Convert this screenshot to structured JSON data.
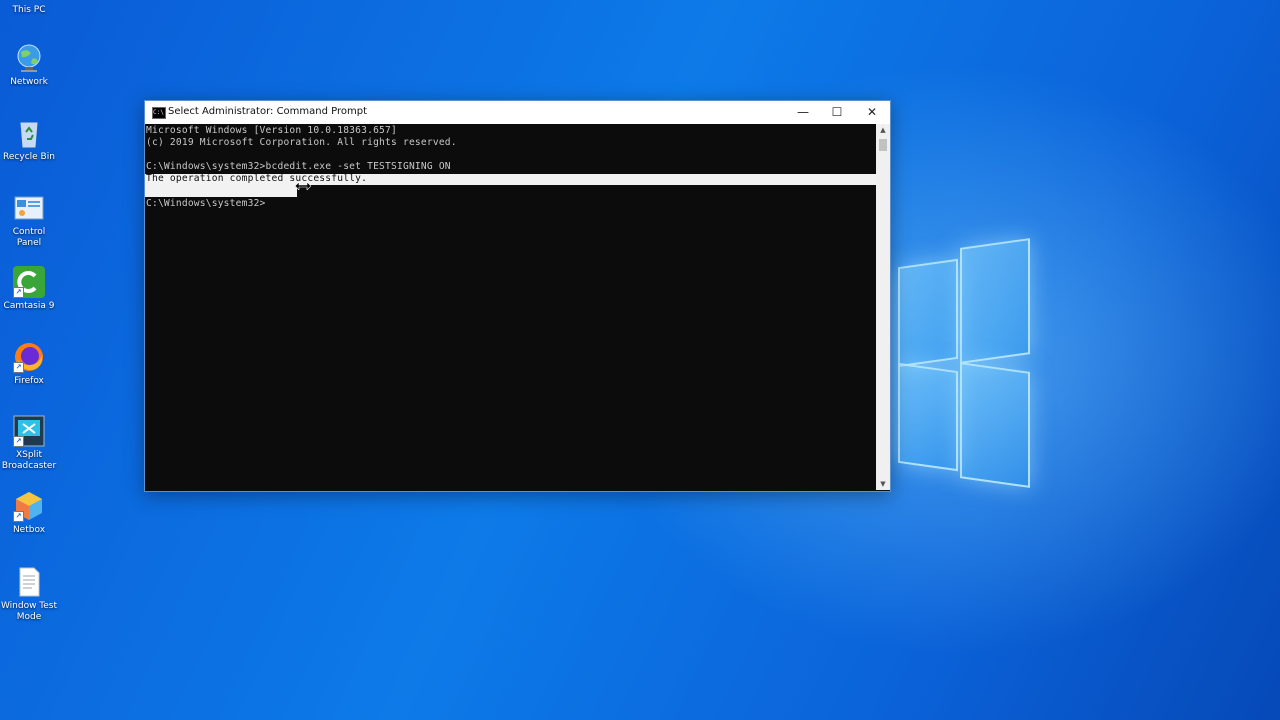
{
  "desktop": {
    "icons": [
      {
        "label": "This PC"
      },
      {
        "label": "Network"
      },
      {
        "label": "Recycle Bin"
      },
      {
        "label": "Control Panel"
      },
      {
        "label": "Camtasia 9"
      },
      {
        "label": "Firefox"
      },
      {
        "label": "XSplit Broadcaster"
      },
      {
        "label": "Netbox"
      },
      {
        "label": "Window Test Mode"
      }
    ]
  },
  "window": {
    "title": "Select Administrator: Command Prompt",
    "app_icon_text": "C:\\",
    "minimize": "—",
    "maximize": "☐",
    "close": "✕"
  },
  "console": {
    "lines": [
      "Microsoft Windows [Version 10.0.18363.657]",
      "(c) 2019 Microsoft Corporation. All rights reserved.",
      "",
      "C:\\Windows\\system32>bcdedit.exe -set TESTSIGNING ON",
      "The operation completed successfully.",
      "",
      "C:\\Windows\\system32>"
    ]
  },
  "scrollbar": {
    "up": "▲",
    "down": "▼"
  },
  "colors": {
    "console_bg": "#0c0c0c",
    "console_text": "#c8c8c8",
    "selection": "#f2f2f2",
    "desktop": "#0b6ee0"
  }
}
